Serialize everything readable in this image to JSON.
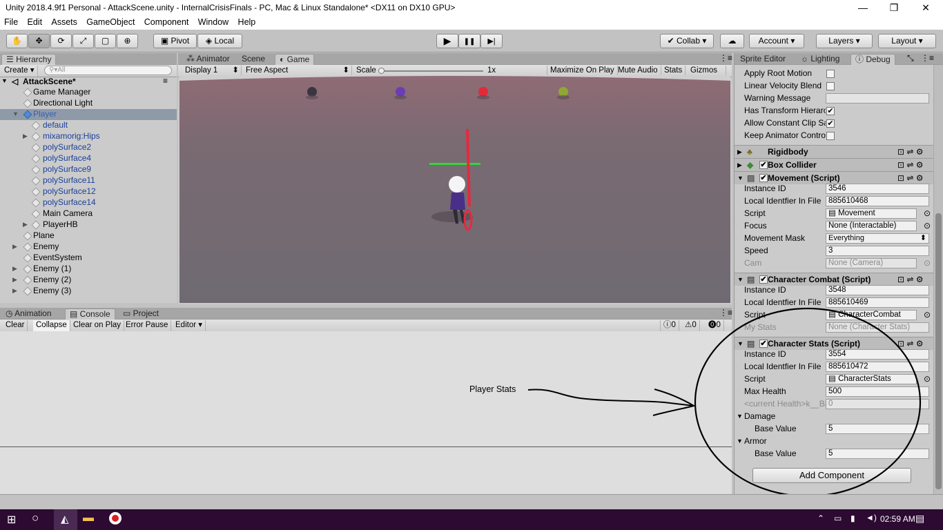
{
  "window": {
    "title": "Unity 2018.4.9f1 Personal - AttackScene.unity - InternalCrisisFinals - PC, Mac & Linux Standalone* <DX11 on DX10 GPU>",
    "minimize": "—",
    "restore": "❐",
    "close": "✕"
  },
  "menu": [
    "File",
    "Edit",
    "Assets",
    "GameObject",
    "Component",
    "Window",
    "Help"
  ],
  "toolbar": {
    "pivot": "Pivot",
    "local": "Local",
    "collab": "Collab",
    "account": "Account",
    "layers": "Layers",
    "layout": "Layout",
    "icons": {
      "hand": "✋",
      "move": "✥",
      "rotate": "⟳",
      "scale": "⤢",
      "rect": "▢",
      "transform": "⊕",
      "play": "▶",
      "pause": "❚❚",
      "step": "▶|",
      "cloud": "☁",
      "dropdown": "▾"
    }
  },
  "hierarchy": {
    "tab": "Hierarchy",
    "create": "Create",
    "search_placeholder": "All",
    "scene": "AttackScene*",
    "items": [
      {
        "label": "Game Manager"
      },
      {
        "label": "Directional Light"
      },
      {
        "label": "Player"
      },
      {
        "label": "default"
      },
      {
        "label": "mixamorig:Hips"
      },
      {
        "label": "polySurface2"
      },
      {
        "label": "polySurface4"
      },
      {
        "label": "polySurface9"
      },
      {
        "label": "polySurface11"
      },
      {
        "label": "polySurface12"
      },
      {
        "label": "polySurface14"
      },
      {
        "label": "Main Camera"
      },
      {
        "label": "PlayerHB"
      },
      {
        "label": "Plane"
      },
      {
        "label": "Enemy"
      },
      {
        "label": "EventSystem"
      },
      {
        "label": "Enemy (1)"
      },
      {
        "label": "Enemy (2)"
      },
      {
        "label": "Enemy (3)"
      }
    ]
  },
  "center": {
    "tabs": [
      "Animator",
      "Scene",
      "Game"
    ],
    "display": "Display 1",
    "aspect": "Free Aspect",
    "scale_label": "Scale",
    "scale_value": "1x",
    "maximize": "Maximize On Play",
    "mute": "Mute Audio",
    "stats": "Stats",
    "gizmos": "Gizmos"
  },
  "console": {
    "tabs": [
      "Animation",
      "Console",
      "Project"
    ],
    "buttons": [
      "Clear",
      "Collapse",
      "Clear on Play",
      "Error Pause",
      "Editor"
    ],
    "counts": [
      "0",
      "0",
      "0"
    ],
    "annotation": "Player Stats"
  },
  "inspector": {
    "tabs": [
      "Sprite Editor",
      "Lighting",
      "Debug"
    ],
    "animator_rows": [
      {
        "label": "Apply Root Motion",
        "type": "check",
        "checked": false
      },
      {
        "label": "Linear Velocity Blend",
        "type": "check",
        "checked": false
      },
      {
        "label": "Warning Message",
        "type": "text",
        "value": ""
      },
      {
        "label": "Has Transform Hierarchy",
        "type": "check",
        "checked": true
      },
      {
        "label": "Allow Constant Clip Sampling",
        "type": "check",
        "checked": true
      },
      {
        "label": "Keep Animator Controller State",
        "type": "check",
        "checked": false
      }
    ],
    "rigidbody": "Rigidbody",
    "boxcollider": "Box Collider",
    "movement": {
      "title": "Movement (Script)",
      "instance_label": "Instance ID",
      "instance": "3546",
      "file_label": "Local Identfier In File",
      "file": "885610468",
      "script_label": "Script",
      "script": "Movement",
      "focus_label": "Focus",
      "focus": "None (Interactable)",
      "mask_label": "Movement Mask",
      "mask": "Everything",
      "speed_label": "Speed",
      "speed": "3",
      "cam_label": "Cam",
      "cam": "None (Camera)"
    },
    "combat": {
      "title": "Character Combat (Script)",
      "instance_label": "Instance ID",
      "instance": "3548",
      "file_label": "Local Identfier In File",
      "file": "885610469",
      "script_label": "Script",
      "script": "CharacterCombat",
      "stats_label": "My Stats",
      "stats": "None (Character Stats)"
    },
    "charstats": {
      "title": "Character Stats (Script)",
      "instance_label": "Instance ID",
      "instance": "3554",
      "file_label": "Local Identfier In File",
      "file": "885610472",
      "script_label": "Script",
      "script": "CharacterStats",
      "maxhealth_label": "Max Health",
      "maxhealth": "500",
      "current_label": "<current Health>k__BackingField",
      "current": "0",
      "damage_label": "Damage",
      "damage_base_label": "Base Value",
      "damage_base": "5",
      "armor_label": "Armor",
      "armor_base_label": "Base Value",
      "armor_base": "5"
    },
    "add_component": "Add Component"
  },
  "taskbar": {
    "time": "02:59 AM"
  },
  "colors": {
    "selection": "#8e9aa8",
    "taskbar": "#2d0a32",
    "health_bar": "#2fd83a",
    "sword": "#e8283e"
  }
}
